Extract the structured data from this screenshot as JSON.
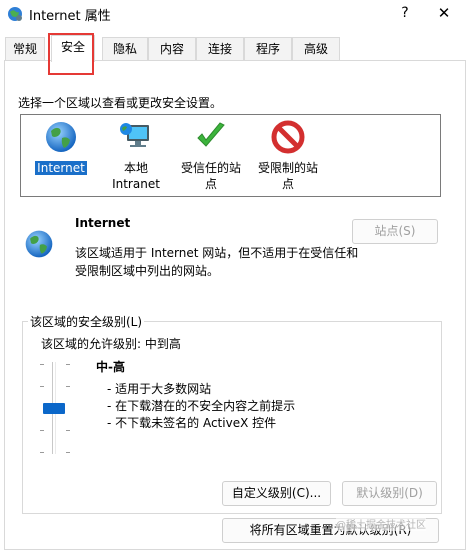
{
  "window": {
    "title": "Internet 属性",
    "help": "?",
    "close": "✕"
  },
  "tabs": [
    {
      "label": "常规"
    },
    {
      "label": "安全"
    },
    {
      "label": "隐私"
    },
    {
      "label": "内容"
    },
    {
      "label": "连接"
    },
    {
      "label": "程序"
    },
    {
      "label": "高级"
    }
  ],
  "security": {
    "zone_prompt": "选择一个区域以查看或更改安全设置。",
    "zones": [
      {
        "label": "Internet",
        "icon": "globe-icon"
      },
      {
        "label_line1": "本地",
        "label_line2": "Intranet",
        "icon": "intranet-icon"
      },
      {
        "label_line1": "受信任的站",
        "label_line2": "点",
        "icon": "checkmark-icon"
      },
      {
        "label_line1": "受限制的站",
        "label_line2": "点",
        "icon": "restricted-icon"
      }
    ],
    "selected": {
      "name": "Internet",
      "description": "该区域适用于 Internet 网站，但不适用于在受信任和受限制区域中列出的网站。",
      "sites_button": "站点(S)"
    },
    "level_group_title": "该区域的安全级别(L)",
    "allowed_levels": "该区域的允许级别: 中到高",
    "level_name": "中-高",
    "level_bullets": [
      "- 适用于大多数网站",
      "- 在下载潜在的不安全内容之前提示",
      "- 不下载未签名的 ActiveX 控件"
    ],
    "custom_button": "自定义级别(C)...",
    "default_button": "默认级别(D)",
    "reset_button": "将所有区域重置为默认级别(R)"
  },
  "watermark": "@稀土掘金技术社区",
  "colors": {
    "accent": "#0b67c9",
    "selection": "#1a6fc9",
    "highlight": "#e53935",
    "check": "#3cb43c",
    "restricted": "#d32f2f"
  }
}
